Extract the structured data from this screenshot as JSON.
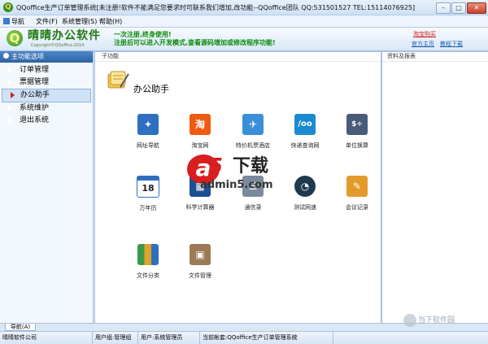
{
  "window": {
    "title": "QQoffice生产订单管理系统[未注册!软件不能满足您要求时可联系我们增加,改功能--QQoffice团队 QQ:531501527 TEL:15114076925]",
    "buttons": {
      "minimize": "–",
      "maximize": "□",
      "close": "✕"
    }
  },
  "menubar": {
    "items": [
      "导航",
      "文件(F)",
      "系统管理(S)",
      "帮助(H)"
    ]
  },
  "banner": {
    "logo_text": "晴晴办公软件",
    "logo_sub": "Copyright©QQoffice.2014",
    "promo_line1": "一次注册,终身使用!",
    "promo_line2": "注册后可以进入开发模式,查看源码增加或修改程序功能!",
    "links": {
      "taobao": "淘宝购买",
      "homepage": "官方主页",
      "tutorial": "教程下载"
    }
  },
  "sidebar": {
    "header": "主功能选项",
    "items": [
      {
        "label": "订单管理",
        "active": false
      },
      {
        "label": "票据管理",
        "active": false
      },
      {
        "label": "办公助手",
        "active": true
      },
      {
        "label": "系统维护",
        "active": false
      },
      {
        "label": "退出系统",
        "active": false
      }
    ]
  },
  "content": {
    "header": "子功能",
    "section_title": "办公助手",
    "tiles": [
      {
        "label": "网址导航",
        "icon": "compass-icon",
        "color": "#2e6fc2"
      },
      {
        "label": "淘宝网",
        "icon": "taobao-icon",
        "color": "#ef5a12"
      },
      {
        "label": "特价机票酒店",
        "icon": "plane-ticket-icon",
        "color": "#3b8fd8"
      },
      {
        "label": "快递查询网",
        "icon": "express-icon",
        "color": "#1b8ad1"
      },
      {
        "label": "单位换算",
        "icon": "calculator-icon",
        "color": "#4a5a78"
      },
      {
        "label": "万年历",
        "icon": "calendar-icon",
        "color": "#2d6fbf"
      },
      {
        "label": "科学计算器",
        "icon": "sci-calc-icon",
        "color": "#1d4f94"
      },
      {
        "label": "通信录",
        "icon": "contacts-icon",
        "color": "#7a8a9c"
      },
      {
        "label": "测试网速",
        "icon": "speed-icon",
        "color": "#1f3a4f"
      },
      {
        "label": "会议记录",
        "icon": "meeting-notes-icon",
        "color": "#e29b2a"
      },
      {
        "label": "文件分类",
        "icon": "books-icon",
        "color": "#3a9a4a"
      },
      {
        "label": "文件管理",
        "icon": "box-icon",
        "color": "#9b7a55"
      }
    ],
    "calendar_day": "18"
  },
  "right_panel": {
    "header": "资料及报表"
  },
  "bottom_tab": {
    "label": "导航(A)"
  },
  "statusbar": {
    "company": "晴晴软件公司",
    "user_group": "用户组:管理组",
    "user": "用户:系统管理员",
    "current": "当前帐套:QQoffice生产订单管理系统"
  },
  "watermark": {
    "badge": "a",
    "five": "5",
    "text": "下载",
    "url": "admin5.com"
  },
  "corner_mark": "当下软件园"
}
